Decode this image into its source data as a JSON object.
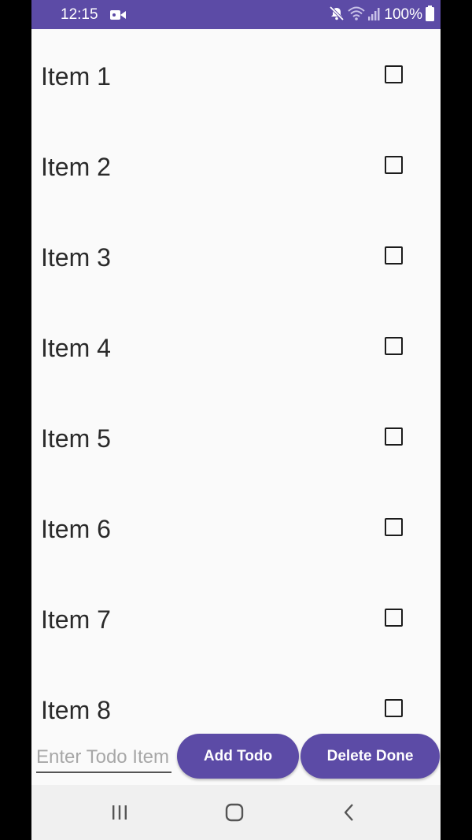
{
  "status_bar": {
    "time": "12:15",
    "battery_text": "100%",
    "background_color": "#5c4ba6",
    "icons": [
      "video-camera-icon",
      "mute-icon",
      "wifi-icon",
      "signal-icon",
      "battery-icon"
    ]
  },
  "todo_list": {
    "items": [
      {
        "label": "Item 1",
        "checked": false
      },
      {
        "label": "Item 2",
        "checked": false
      },
      {
        "label": "Item 3",
        "checked": false
      },
      {
        "label": "Item 4",
        "checked": false
      },
      {
        "label": "Item 5",
        "checked": false
      },
      {
        "label": "Item 6",
        "checked": false
      },
      {
        "label": "Item 7",
        "checked": false
      },
      {
        "label": "Item 8",
        "checked": false
      }
    ]
  },
  "input_bar": {
    "input_placeholder": "Enter Todo Item",
    "input_value": "",
    "add_label": "Add Todo",
    "delete_label": "Delete Done",
    "accent_color": "#5c4ba6"
  },
  "nav_bar": {
    "icons": [
      "recent-apps-icon",
      "home-icon",
      "back-icon"
    ]
  }
}
